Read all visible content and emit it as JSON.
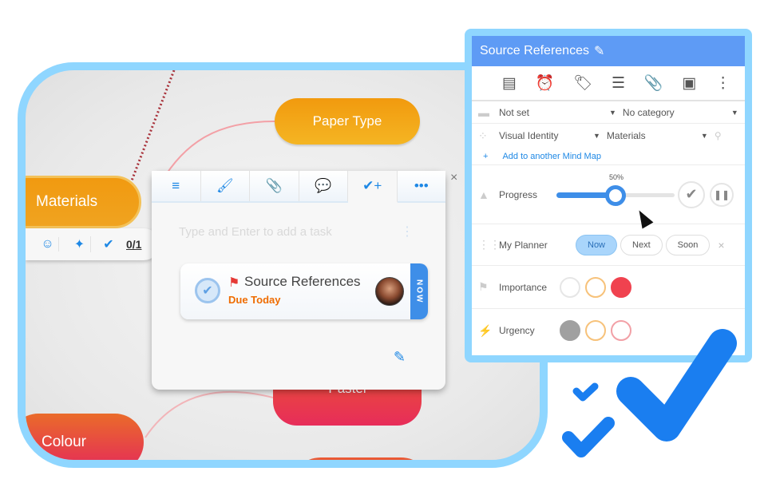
{
  "mindmap": {
    "nodes": {
      "paper_type": "Paper Type",
      "materials": "Materials",
      "pastel": "Pastel",
      "colour": "Colour"
    },
    "node_toolbar": {
      "icons": [
        "emoji-add-icon",
        "collapse-icon",
        "task-check-icon"
      ],
      "task_count": "0/1"
    }
  },
  "task_panel": {
    "tabs": [
      {
        "icon": "notes-icon",
        "glyph": "≡"
      },
      {
        "icon": "paintbrush-icon",
        "glyph": "🖌"
      },
      {
        "icon": "paperclip-icon",
        "glyph": "📎"
      },
      {
        "icon": "comment-icon",
        "glyph": "💬"
      },
      {
        "icon": "task-add-icon",
        "glyph": "✔+"
      },
      {
        "icon": "more-icon",
        "glyph": "•••"
      }
    ],
    "active_tab": 4,
    "input_placeholder": "Type and Enter to add a task",
    "task": {
      "title": "Source References",
      "due": "Due Today",
      "badge": "NOW"
    },
    "close_glyph": "×"
  },
  "properties": {
    "title": "Source References",
    "edit_glyph": "✎",
    "toolbar_icons": [
      {
        "icon": "notes-icon",
        "glyph": "▤"
      },
      {
        "icon": "alarm-icon",
        "glyph": "⏰"
      },
      {
        "icon": "tag-icon",
        "glyph": "🏷"
      },
      {
        "icon": "list-icon",
        "glyph": "☰"
      },
      {
        "icon": "paperclip-icon",
        "glyph": "📎"
      },
      {
        "icon": "image-icon",
        "glyph": "▣"
      },
      {
        "icon": "more-vertical-icon",
        "glyph": "⋮"
      }
    ],
    "folder": {
      "value": "Not set",
      "category": "No category"
    },
    "map": {
      "value": "Visual Identity",
      "node": "Materials",
      "add_link": "Add to another Mind Map",
      "add_glyph": "+"
    },
    "progress": {
      "label": "Progress",
      "value_percent": 50,
      "value_label": "50%"
    },
    "planner": {
      "label": "My Planner",
      "options": [
        "Now",
        "Next",
        "Soon"
      ],
      "selected": "Now",
      "clear_glyph": "×"
    },
    "importance": {
      "label": "Importance",
      "colors": [
        "#ffffff",
        "#ffffff",
        "#f0424f"
      ],
      "borders": [
        "#e6e6e6",
        "#f7c27a",
        "#f0424f"
      ],
      "selected_index": 2
    },
    "urgency": {
      "label": "Urgency",
      "colors": [
        "#a0a0a0",
        "#ffffff",
        "#ffffff"
      ],
      "borders": [
        "#a0a0a0",
        "#f7c27a",
        "#f2a0a6"
      ],
      "selected_index": 0
    }
  },
  "colors": {
    "accent": "#3e8ee8",
    "frame": "#8fd6ff",
    "header": "#5e9bf5",
    "check_marks": "#1a7ef0"
  }
}
